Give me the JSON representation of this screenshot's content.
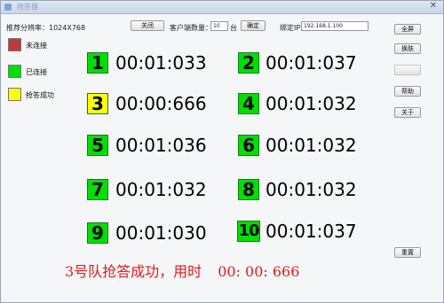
{
  "window": {
    "title": "抢答器"
  },
  "toolbar": {
    "resolution_label": "推荐分辨率：1024X768",
    "close_label": "关闭",
    "client_count_label": "客户端数量：",
    "client_count_value": "10",
    "client_count_unit": "台",
    "confirm_label": "确定",
    "bind_ip_label": "绑定IP：",
    "bind_ip_value": "192.168.1.100"
  },
  "legend": [
    {
      "label": "未连接",
      "color": "#c0393b"
    },
    {
      "label": "已连接",
      "color": "#00e000"
    },
    {
      "label": "抢答成功",
      "color": "#ffff00"
    }
  ],
  "teams": [
    {
      "number": "1",
      "time": "00:01:033",
      "state": "connected"
    },
    {
      "number": "2",
      "time": "00:01:037",
      "state": "connected"
    },
    {
      "number": "3",
      "time": "00:00:666",
      "state": "winner"
    },
    {
      "number": "4",
      "time": "00:01:032",
      "state": "connected"
    },
    {
      "number": "5",
      "time": "00:01:036",
      "state": "connected"
    },
    {
      "number": "6",
      "time": "00:01:032",
      "state": "connected"
    },
    {
      "number": "7",
      "time": "00:01:032",
      "state": "connected"
    },
    {
      "number": "8",
      "time": "00:01:032",
      "state": "connected"
    },
    {
      "number": "9",
      "time": "00:01:030",
      "state": "connected"
    },
    {
      "number": "10",
      "time": "00:01:037",
      "state": "connected"
    }
  ],
  "state_colors": {
    "connected": "#00e000",
    "winner": "#ffff00",
    "disconnected": "#c0393b"
  },
  "side_buttons": {
    "fullscreen": "全屏",
    "switch": "换肤",
    "blank": "",
    "help": "帮助",
    "about": "关于",
    "reset": "重置"
  },
  "result": {
    "message": "3号队抢答成功，用时",
    "time": "00: 00: 666"
  }
}
